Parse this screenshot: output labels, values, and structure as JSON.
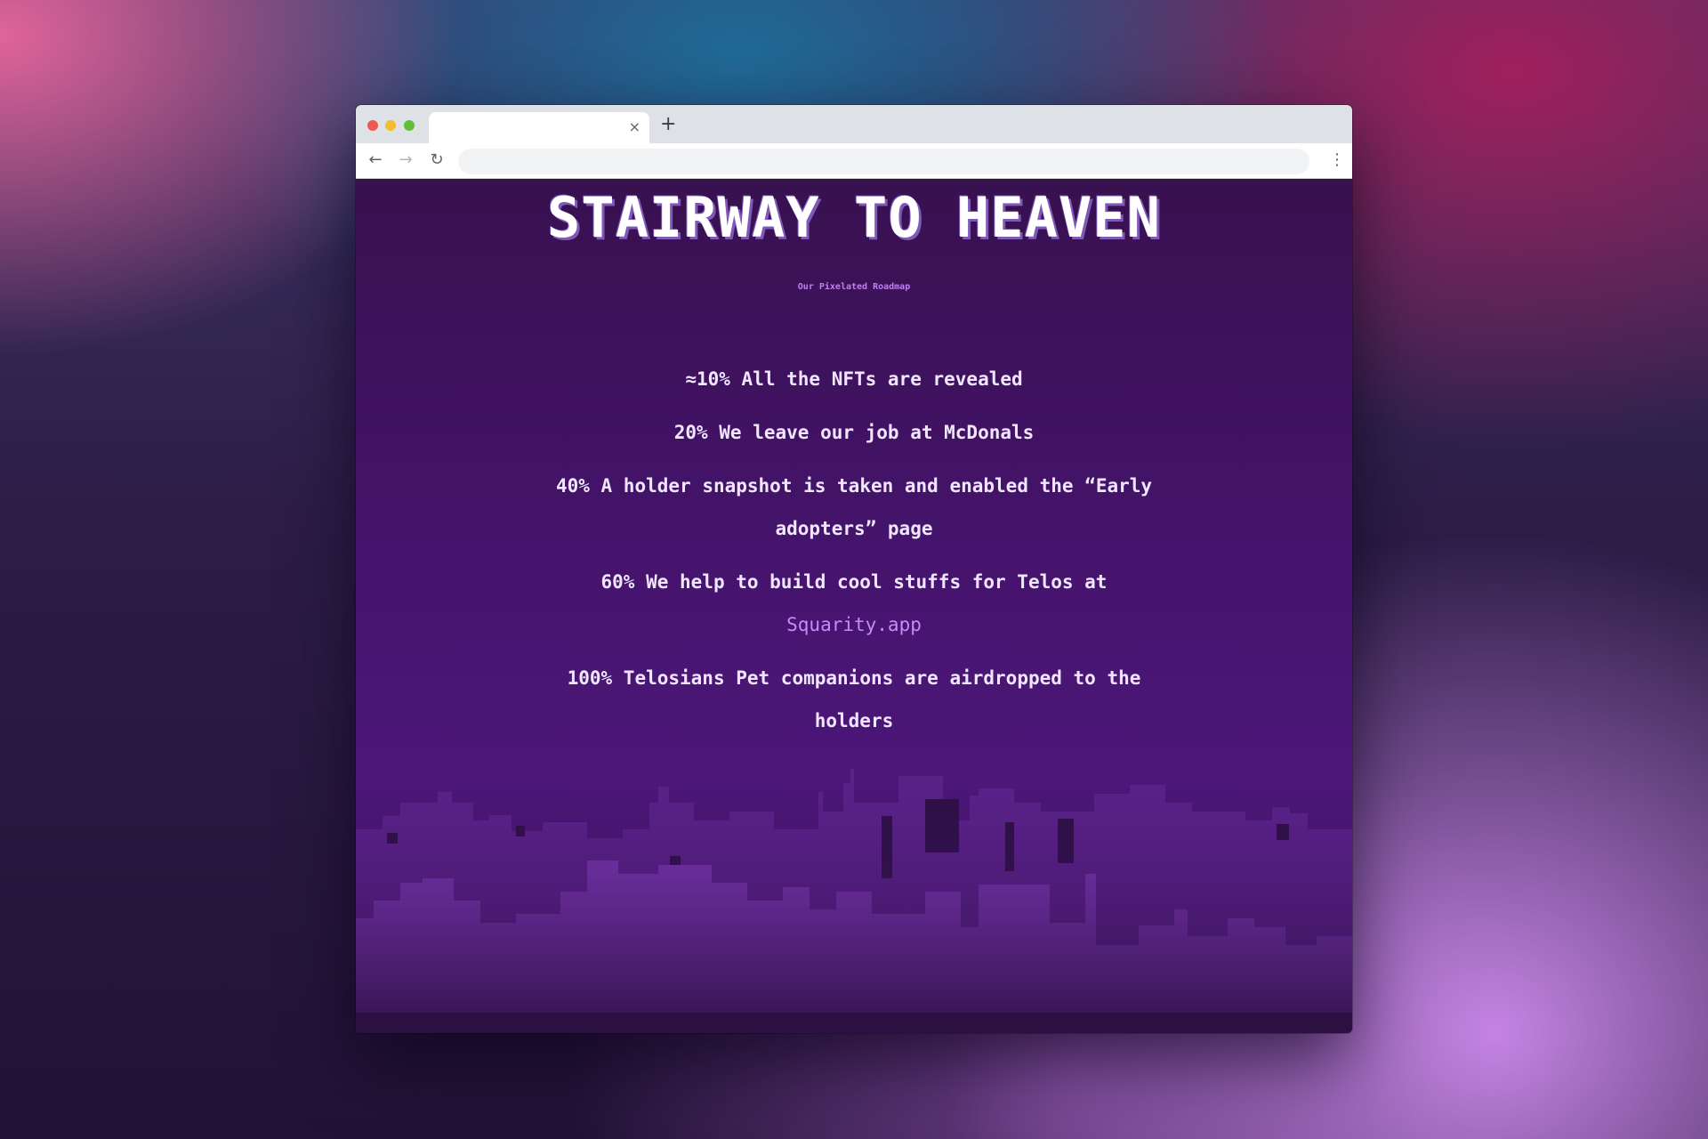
{
  "browser": {
    "tab_close": "×",
    "new_tab": "+",
    "back_icon": "←",
    "forward_icon": "→",
    "reload_icon": "↻",
    "menu_icon": "⋮",
    "address_value": ""
  },
  "page": {
    "title": "STAIRWAY TO HEAVEN",
    "subtitle": "Our Pixelated Roadmap",
    "milestones": [
      {
        "text": "≈10% All the NFTs are revealed"
      },
      {
        "text": "20% We leave our job at McDonals"
      },
      {
        "text": "40% A holder snapshot is taken and enabled the “Early adopters” page"
      },
      {
        "text": "60% We help to build cool stuffs for Telos at",
        "link": "Squarity.app"
      },
      {
        "text": "100% Telosians Pet companions are airdropped to the holders"
      }
    ]
  },
  "colors": {
    "page_background": "#44136a",
    "title_shadow": "#7f58b8",
    "subtitle": "#c07ef0",
    "link": "#c78af7",
    "city_dark": "#2a0f3f",
    "city_mid": "#5a2289",
    "city_light": "#7d39b5"
  }
}
